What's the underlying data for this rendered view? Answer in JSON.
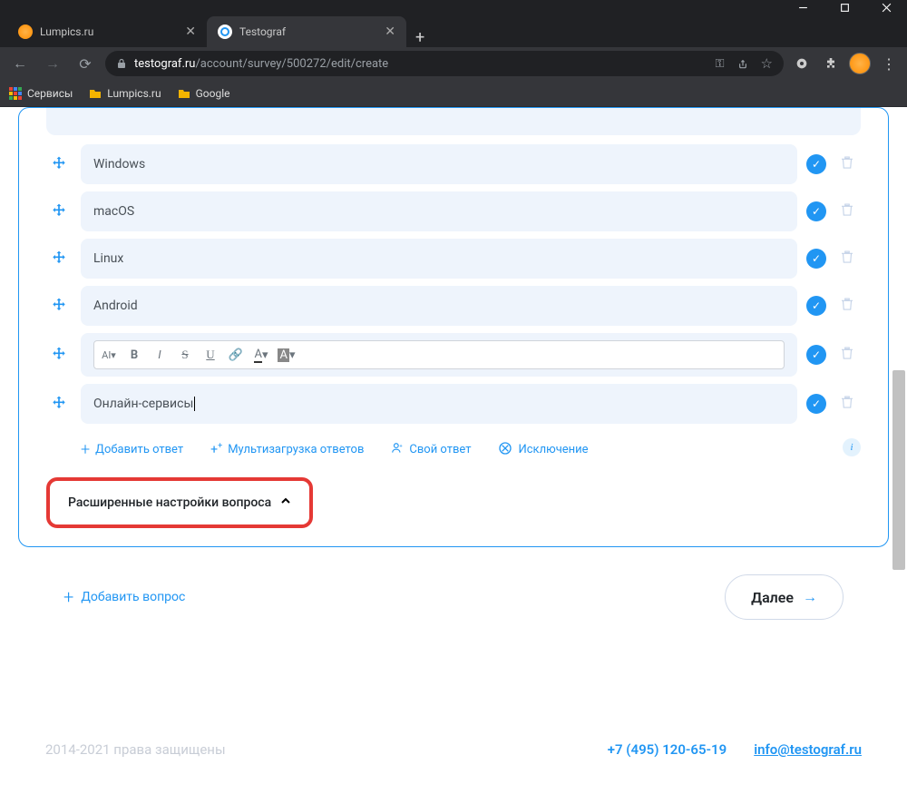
{
  "window": {
    "title": "Testograf"
  },
  "tabs": [
    {
      "title": "Lumpics.ru",
      "active": false
    },
    {
      "title": "Testograf",
      "active": true
    }
  ],
  "address": {
    "domain": "testograf.ru",
    "path": "/account/survey/500272/edit/create"
  },
  "bookmarks": {
    "services": "Сервисы",
    "lumpics": "Lumpics.ru",
    "google": "Google"
  },
  "options": [
    "Windows",
    "macOS",
    "Linux",
    "Android",
    "",
    "Онлайн-сервисы"
  ],
  "actions": {
    "add_answer": "Добавить ответ",
    "multi_upload": "Мультизагрузка ответов",
    "custom_answer": "Свой ответ",
    "exclude": "Исключение"
  },
  "advanced_settings": "Расширенные настройки вопроса",
  "add_question": "Добавить вопрос",
  "next_button": "Далее",
  "footer": {
    "copyright": "2014-2021 права защищены",
    "phone": "+7 (495) 120-65-19",
    "email": "info@testograf.ru"
  },
  "toolbar_buttons": [
    "AI",
    "B",
    "I",
    "S",
    "U",
    "🔗",
    "A",
    "A"
  ]
}
